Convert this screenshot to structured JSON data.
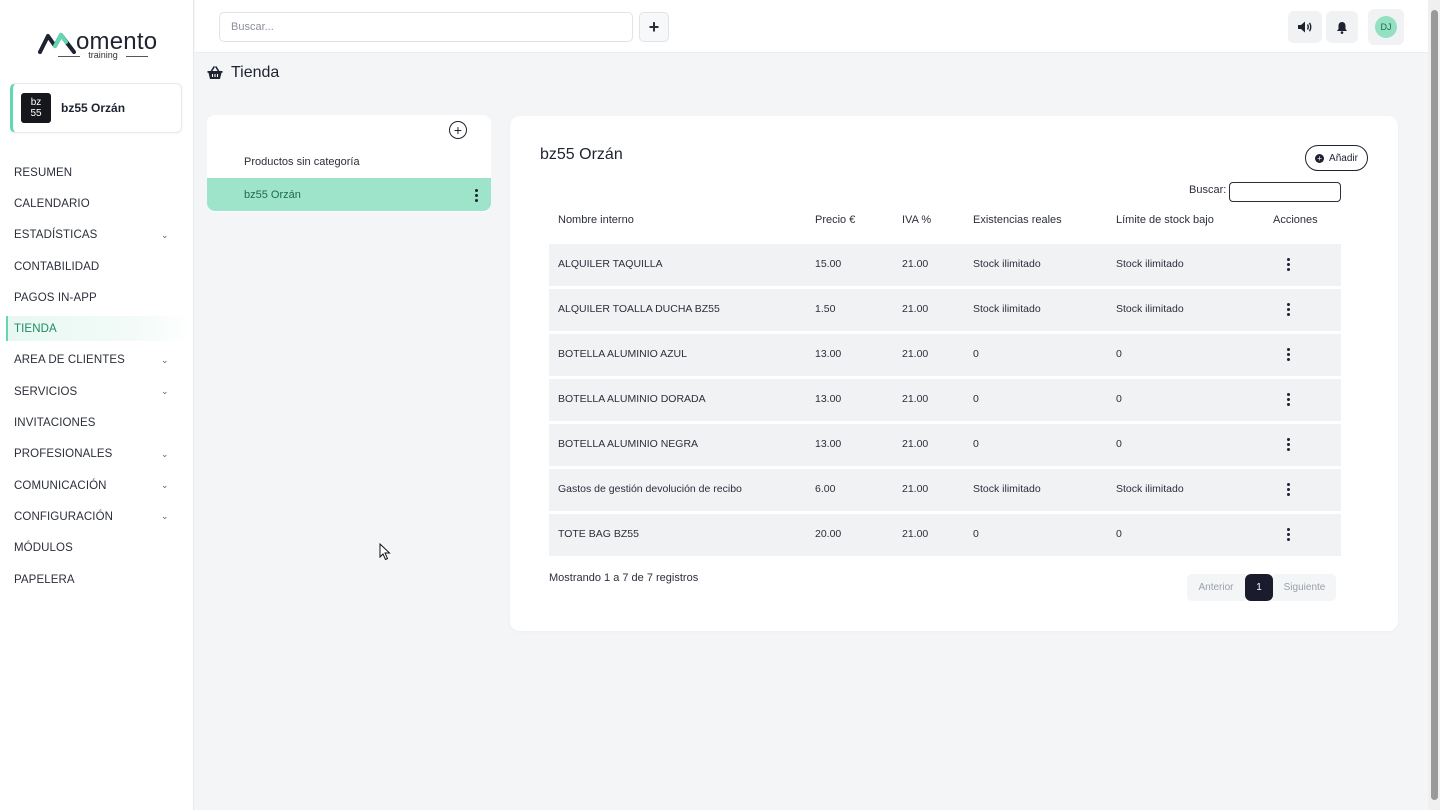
{
  "brand": {
    "name": "omento",
    "subtitle": "training"
  },
  "account": {
    "logo_text_top": "bz",
    "logo_text_bottom": "55",
    "name": "bz55 Orzán"
  },
  "sidebar": {
    "items": [
      {
        "label": "RESUMEN",
        "has_chevron": false
      },
      {
        "label": "CALENDARIO",
        "has_chevron": false
      },
      {
        "label": "ESTADÍSTICAS",
        "has_chevron": true
      },
      {
        "label": "CONTABILIDAD",
        "has_chevron": false
      },
      {
        "label": "PAGOS IN-APP",
        "has_chevron": false
      },
      {
        "label": "TIENDA",
        "has_chevron": false,
        "active": true
      },
      {
        "label": "AREA DE CLIENTES",
        "has_chevron": true
      },
      {
        "label": "SERVICIOS",
        "has_chevron": true
      },
      {
        "label": "INVITACIONES",
        "has_chevron": false
      },
      {
        "label": "PROFESIONALES",
        "has_chevron": true
      },
      {
        "label": "COMUNICACIÓN",
        "has_chevron": true
      },
      {
        "label": "CONFIGURACIÓN",
        "has_chevron": true
      },
      {
        "label": "MÓDULOS",
        "has_chevron": false
      },
      {
        "label": "PAPELERA",
        "has_chevron": false
      }
    ]
  },
  "topbar": {
    "search_placeholder": "Buscar...",
    "plus_icon": "+",
    "avatar_initials": "DJ"
  },
  "page": {
    "title": "Tienda"
  },
  "categories": {
    "items": [
      {
        "label": "Productos sin categoría",
        "selected": false
      },
      {
        "label": "bz55 Orzán",
        "selected": true
      }
    ]
  },
  "main": {
    "title": "bz55 Orzán",
    "add_label": "Añadir",
    "search_label": "Buscar:",
    "columns": [
      "Nombre interno",
      "Precio €",
      "IVA %",
      "Existencias reales",
      "Límite de stock bajo",
      "Acciones"
    ],
    "rows": [
      {
        "name": "ALQUILER TAQUILLA",
        "price": "15.00",
        "iva": "21.00",
        "stock": "Stock ilimitado",
        "low": "Stock ilimitado"
      },
      {
        "name": "ALQUILER TOALLA DUCHA BZ55",
        "price": "1.50",
        "iva": "21.00",
        "stock": "Stock ilimitado",
        "low": "Stock ilimitado"
      },
      {
        "name": "BOTELLA ALUMINIO AZUL",
        "price": "13.00",
        "iva": "21.00",
        "stock": "0",
        "low": "0"
      },
      {
        "name": "BOTELLA ALUMINIO DORADA",
        "price": "13.00",
        "iva": "21.00",
        "stock": "0",
        "low": "0"
      },
      {
        "name": "BOTELLA ALUMINIO NEGRA",
        "price": "13.00",
        "iva": "21.00",
        "stock": "0",
        "low": "0"
      },
      {
        "name": "Gastos de gestión devolución de recibo",
        "price": "6.00",
        "iva": "21.00",
        "stock": "Stock ilimitado",
        "low": "Stock ilimitado"
      },
      {
        "name": "TOTE BAG BZ55",
        "price": "20.00",
        "iva": "21.00",
        "stock": "0",
        "low": "0"
      }
    ],
    "info": "Mostrando 1 a 7 de 7 registros",
    "pager": {
      "prev": "Anterior",
      "current": "1",
      "next": "Siguiente"
    }
  },
  "colors": {
    "accent": "#62d7b2",
    "selected_bg": "#9ee4cb",
    "dark": "#1b1b2e"
  }
}
